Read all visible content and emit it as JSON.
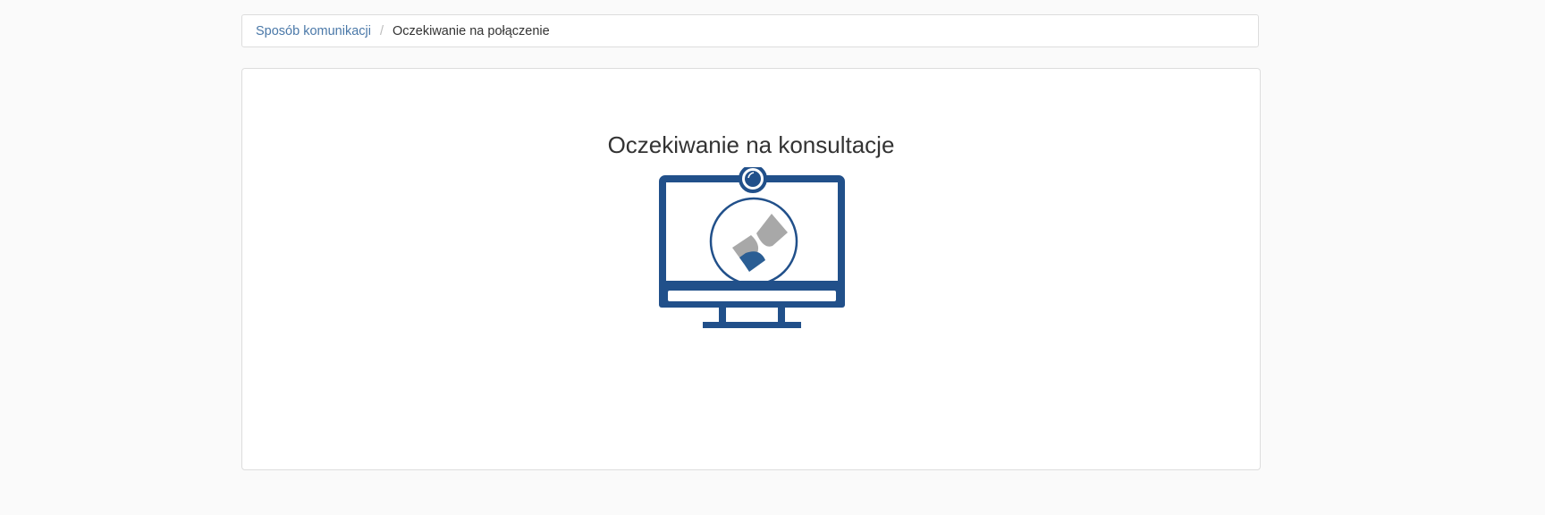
{
  "breadcrumb": {
    "link_label": "Sposób komunikacji",
    "separator": "/",
    "current_label": "Oczekiwanie na połączenie"
  },
  "panel": {
    "title": "Oczekiwanie na konsultacje"
  },
  "colors": {
    "monitor_blue": "#21508a",
    "hourglass_gray": "#a8a8a8",
    "hourglass_blue": "#2b5e94",
    "link_blue": "#4a78a8"
  },
  "icons": {
    "monitor": "monitor-webcam-icon",
    "hourglass": "hourglass-icon"
  }
}
